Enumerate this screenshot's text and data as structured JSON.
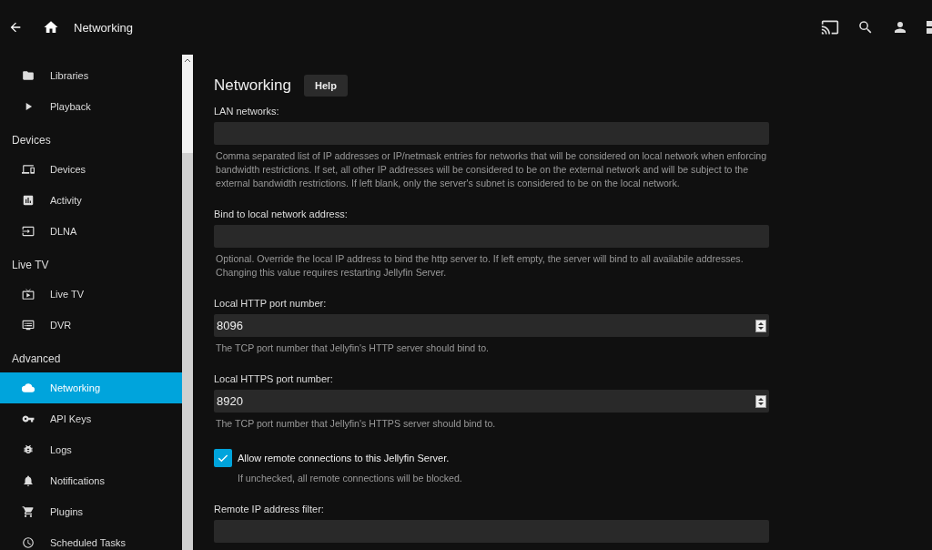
{
  "header": {
    "title": "Networking"
  },
  "sidebar": {
    "groups": [
      {
        "items": [
          {
            "label": "Libraries",
            "selected": false
          },
          {
            "label": "Playback",
            "selected": false
          }
        ]
      },
      {
        "heading": "Devices",
        "items": [
          {
            "label": "Devices",
            "selected": false
          },
          {
            "label": "Activity",
            "selected": false
          },
          {
            "label": "DLNA",
            "selected": false
          }
        ]
      },
      {
        "heading": "Live TV",
        "items": [
          {
            "label": "Live TV",
            "selected": false
          },
          {
            "label": "DVR",
            "selected": false
          }
        ]
      },
      {
        "heading": "Advanced",
        "items": [
          {
            "label": "Networking",
            "selected": true
          },
          {
            "label": "API Keys",
            "selected": false
          },
          {
            "label": "Logs",
            "selected": false
          },
          {
            "label": "Notifications",
            "selected": false
          },
          {
            "label": "Plugins",
            "selected": false
          },
          {
            "label": "Scheduled Tasks",
            "selected": false
          }
        ]
      }
    ]
  },
  "page": {
    "title": "Networking",
    "help_button": "Help",
    "fields": [
      {
        "kind": "text",
        "label": "LAN networks:",
        "description": "Comma separated list of IP addresses or IP/netmask entries for networks that will be considered on local network when enforcing bandwidth restrictions. If set, all other IP addresses will be considered to be on the external network and will be subject to the external bandwidth restrictions. If left blank, only the server's subnet is considered to be on the local network."
      },
      {
        "kind": "text",
        "label": "Bind to local network address:",
        "description": "Optional. Override the local IP address to bind the http server to. If left empty, the server will bind to all availabile addresses. Changing this value requires restarting Jellyfin Server."
      },
      {
        "kind": "number",
        "label": "Local HTTP port number:",
        "value": "8096",
        "description": "The TCP port number that Jellyfin's HTTP server should bind to."
      },
      {
        "kind": "number",
        "label": "Local HTTPS port number:",
        "value": "8920",
        "description": "The TCP port number that Jellyfin's HTTPS server should bind to."
      },
      {
        "kind": "checkbox",
        "label": "Allow remote connections to this Jellyfin Server.",
        "checked": true,
        "description": "If unchecked, all remote connections will be blocked."
      },
      {
        "kind": "text",
        "label": "Remote IP address filter:"
      }
    ]
  }
}
